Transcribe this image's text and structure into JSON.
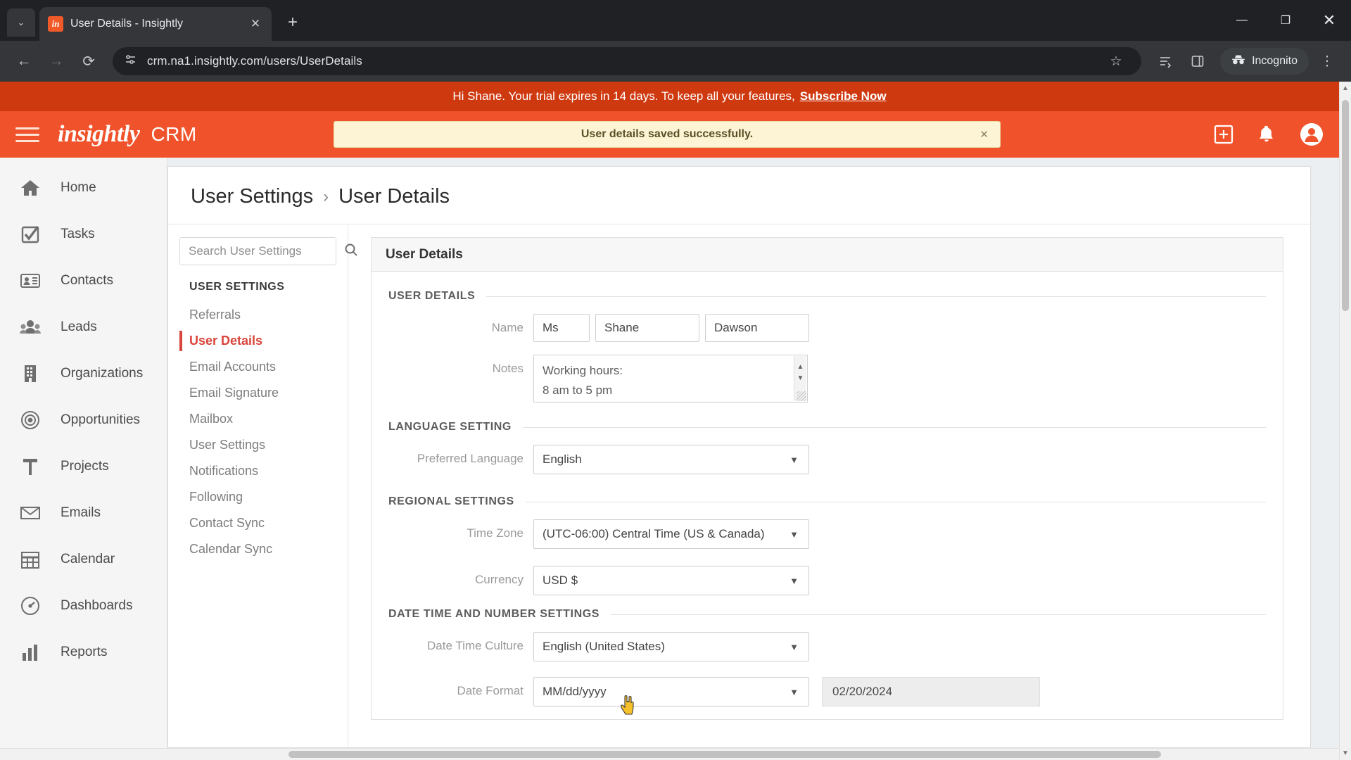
{
  "browser": {
    "tab": {
      "title": "User Details - Insightly",
      "favicon": "in",
      "close_label": "✕"
    },
    "tab_list_label": "⌄",
    "new_tab_label": "+",
    "window": {
      "minimize": "—",
      "maximize": "❐",
      "close": "✕"
    },
    "nav": {
      "back": "←",
      "forward": "→",
      "reload": "⟳"
    },
    "url": "crm.na1.insightly.com/users/UserDetails",
    "icons": {
      "site_info": "page-info-icon",
      "bookmark": "☆",
      "reading_list": "reading-list-icon",
      "side_panel": "side-panel-icon",
      "menu": "⋮"
    },
    "incognito_label": "Incognito"
  },
  "trial": {
    "message": "Hi Shane. Your trial expires in 14 days. To keep all your features,",
    "cta": "Subscribe Now"
  },
  "header": {
    "brand": "insightly",
    "brand_sub": "CRM",
    "toast": {
      "text": "User details saved successfully.",
      "close": "✕"
    },
    "add_label": "+",
    "bell_label": "notifications-icon",
    "account_label": "account-icon"
  },
  "sidebar": {
    "items": [
      {
        "label": "Home",
        "icon": "home-icon"
      },
      {
        "label": "Tasks",
        "icon": "tasks-icon"
      },
      {
        "label": "Contacts",
        "icon": "contacts-icon"
      },
      {
        "label": "Leads",
        "icon": "leads-icon"
      },
      {
        "label": "Organizations",
        "icon": "organizations-icon"
      },
      {
        "label": "Opportunities",
        "icon": "opportunities-icon"
      },
      {
        "label": "Projects",
        "icon": "projects-icon"
      },
      {
        "label": "Emails",
        "icon": "emails-icon"
      },
      {
        "label": "Calendar",
        "icon": "calendar-icon"
      },
      {
        "label": "Dashboards",
        "icon": "dashboards-icon"
      },
      {
        "label": "Reports",
        "icon": "reports-icon"
      }
    ]
  },
  "breadcrumb": {
    "parent": "User Settings",
    "separator": "›",
    "current": "User Details"
  },
  "settings_nav": {
    "search_placeholder": "Search User Settings",
    "search_value": "",
    "search_icon": "search-icon",
    "group_title": "USER SETTINGS",
    "items": [
      {
        "label": "Referrals",
        "active": false
      },
      {
        "label": "User Details",
        "active": true
      },
      {
        "label": "Email Accounts",
        "active": false
      },
      {
        "label": "Email Signature",
        "active": false
      },
      {
        "label": "Mailbox",
        "active": false
      },
      {
        "label": "User Settings",
        "active": false
      },
      {
        "label": "Notifications",
        "active": false
      },
      {
        "label": "Following",
        "active": false
      },
      {
        "label": "Contact Sync",
        "active": false
      },
      {
        "label": "Calendar Sync",
        "active": false
      }
    ]
  },
  "panel": {
    "title": "User Details",
    "sections": {
      "user_details": {
        "legend": "USER DETAILS",
        "name_label": "Name",
        "salutation": "Ms",
        "first_name": "Shane",
        "last_name": "Dawson",
        "notes_label": "Notes",
        "notes_line1": "Working hours:",
        "notes_line2": "8 am to 5 pm"
      },
      "language": {
        "legend": "LANGUAGE SETTING",
        "preferred_language_label": "Preferred Language",
        "preferred_language_value": "English"
      },
      "regional": {
        "legend": "REGIONAL SETTINGS",
        "timezone_label": "Time Zone",
        "timezone_value": "(UTC-06:00) Central Time (US & Canada)",
        "currency_label": "Currency",
        "currency_value": "USD $"
      },
      "datetime": {
        "legend": "DATE TIME AND NUMBER SETTINGS",
        "culture_label": "Date Time Culture",
        "culture_value": "English (United States)",
        "date_format_label": "Date Format",
        "date_format_value": "MM/dd/yyyy",
        "date_preview": "02/20/2024"
      }
    }
  },
  "colors": {
    "brand_orange": "#f0532b",
    "banner_orange": "#cf3910",
    "active_red": "#d9453c",
    "toast_bg": "#fcf4d4"
  }
}
